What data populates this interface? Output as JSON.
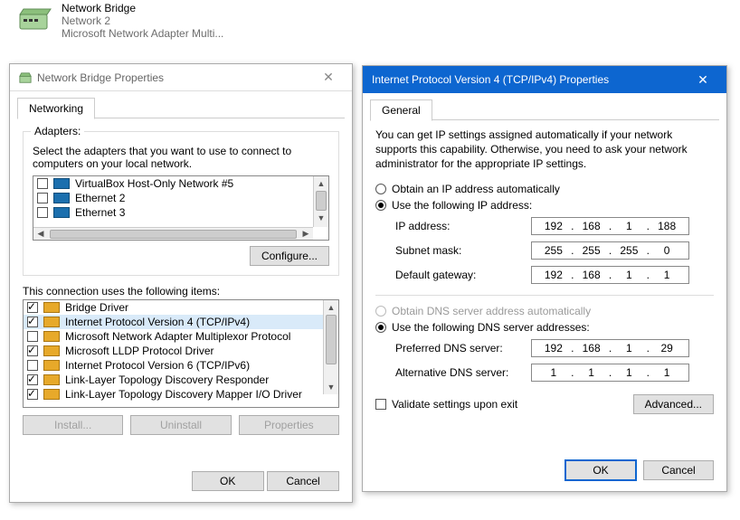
{
  "desktop_item": {
    "title": "Network Bridge",
    "line2": "Network 2",
    "line3": "Microsoft Network Adapter Multi..."
  },
  "left": {
    "title": "Network Bridge Properties",
    "tab": "Networking",
    "group_label": "Adapters:",
    "group_hint1": "Select the adapters that you want to use to connect to",
    "group_hint2": "computers on your local network.",
    "adapters": [
      {
        "label": "VirtualBox Host-Only Network #5",
        "checked": false
      },
      {
        "label": "Ethernet 2",
        "checked": false
      },
      {
        "label": "Ethernet 3",
        "checked": false
      }
    ],
    "configure": "Configure...",
    "items_label": "This connection uses the following items:",
    "items": [
      {
        "label": "Bridge Driver",
        "checked": true,
        "icon": "proto",
        "selected": false
      },
      {
        "label": "Internet Protocol Version 4 (TCP/IPv4)",
        "checked": true,
        "icon": "proto",
        "selected": true
      },
      {
        "label": "Microsoft Network Adapter Multiplexor Protocol",
        "checked": false,
        "icon": "proto",
        "selected": false
      },
      {
        "label": "Microsoft LLDP Protocol Driver",
        "checked": true,
        "icon": "proto",
        "selected": false
      },
      {
        "label": "Internet Protocol Version 6 (TCP/IPv6)",
        "checked": false,
        "icon": "proto",
        "selected": false
      },
      {
        "label": "Link-Layer Topology Discovery Responder",
        "checked": true,
        "icon": "proto",
        "selected": false
      },
      {
        "label": "Link-Layer Topology Discovery Mapper I/O Driver",
        "checked": true,
        "icon": "proto",
        "selected": false
      }
    ],
    "install": "Install...",
    "uninstall": "Uninstall",
    "properties": "Properties",
    "ok": "OK",
    "cancel": "Cancel"
  },
  "right": {
    "title": "Internet Protocol Version 4 (TCP/IPv4) Properties",
    "tab": "General",
    "intro": "You can get IP settings assigned automatically if your network supports this capability. Otherwise, you need to ask your network administrator for the appropriate IP settings.",
    "r_auto_ip": "Obtain an IP address automatically",
    "r_manual_ip": "Use the following IP address:",
    "lbl_ip": "IP address:",
    "lbl_mask": "Subnet mask:",
    "lbl_gw": "Default gateway:",
    "ip": {
      "a": "192",
      "b": "168",
      "c": "1",
      "d": "188"
    },
    "mask": {
      "a": "255",
      "b": "255",
      "c": "255",
      "d": "0"
    },
    "gw": {
      "a": "192",
      "b": "168",
      "c": "1",
      "d": "1"
    },
    "r_auto_dns": "Obtain DNS server address automatically",
    "r_manual_dns": "Use the following DNS server addresses:",
    "lbl_dns1": "Preferred DNS server:",
    "lbl_dns2": "Alternative DNS server:",
    "dns1": {
      "a": "192",
      "b": "168",
      "c": "1",
      "d": "29"
    },
    "dns2": {
      "a": "1",
      "b": "1",
      "c": "1",
      "d": "1"
    },
    "validate": "Validate settings upon exit",
    "advanced": "Advanced...",
    "ok": "OK",
    "cancel": "Cancel"
  }
}
